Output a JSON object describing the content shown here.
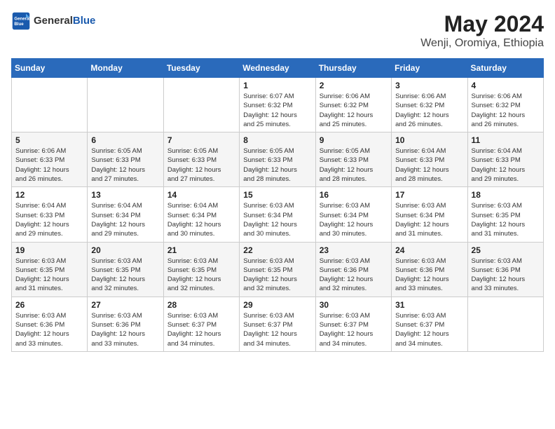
{
  "header": {
    "logo_general": "General",
    "logo_blue": "Blue",
    "title": "May 2024",
    "location": "Wenji, Oromiya, Ethiopia"
  },
  "days_of_week": [
    "Sunday",
    "Monday",
    "Tuesday",
    "Wednesday",
    "Thursday",
    "Friday",
    "Saturday"
  ],
  "weeks": [
    [
      {
        "day": "",
        "info": ""
      },
      {
        "day": "",
        "info": ""
      },
      {
        "day": "",
        "info": ""
      },
      {
        "day": "1",
        "info": "Sunrise: 6:07 AM\nSunset: 6:32 PM\nDaylight: 12 hours\nand 25 minutes."
      },
      {
        "day": "2",
        "info": "Sunrise: 6:06 AM\nSunset: 6:32 PM\nDaylight: 12 hours\nand 25 minutes."
      },
      {
        "day": "3",
        "info": "Sunrise: 6:06 AM\nSunset: 6:32 PM\nDaylight: 12 hours\nand 26 minutes."
      },
      {
        "day": "4",
        "info": "Sunrise: 6:06 AM\nSunset: 6:32 PM\nDaylight: 12 hours\nand 26 minutes."
      }
    ],
    [
      {
        "day": "5",
        "info": "Sunrise: 6:06 AM\nSunset: 6:33 PM\nDaylight: 12 hours\nand 26 minutes."
      },
      {
        "day": "6",
        "info": "Sunrise: 6:05 AM\nSunset: 6:33 PM\nDaylight: 12 hours\nand 27 minutes."
      },
      {
        "day": "7",
        "info": "Sunrise: 6:05 AM\nSunset: 6:33 PM\nDaylight: 12 hours\nand 27 minutes."
      },
      {
        "day": "8",
        "info": "Sunrise: 6:05 AM\nSunset: 6:33 PM\nDaylight: 12 hours\nand 28 minutes."
      },
      {
        "day": "9",
        "info": "Sunrise: 6:05 AM\nSunset: 6:33 PM\nDaylight: 12 hours\nand 28 minutes."
      },
      {
        "day": "10",
        "info": "Sunrise: 6:04 AM\nSunset: 6:33 PM\nDaylight: 12 hours\nand 28 minutes."
      },
      {
        "day": "11",
        "info": "Sunrise: 6:04 AM\nSunset: 6:33 PM\nDaylight: 12 hours\nand 29 minutes."
      }
    ],
    [
      {
        "day": "12",
        "info": "Sunrise: 6:04 AM\nSunset: 6:33 PM\nDaylight: 12 hours\nand 29 minutes."
      },
      {
        "day": "13",
        "info": "Sunrise: 6:04 AM\nSunset: 6:34 PM\nDaylight: 12 hours\nand 29 minutes."
      },
      {
        "day": "14",
        "info": "Sunrise: 6:04 AM\nSunset: 6:34 PM\nDaylight: 12 hours\nand 30 minutes."
      },
      {
        "day": "15",
        "info": "Sunrise: 6:03 AM\nSunset: 6:34 PM\nDaylight: 12 hours\nand 30 minutes."
      },
      {
        "day": "16",
        "info": "Sunrise: 6:03 AM\nSunset: 6:34 PM\nDaylight: 12 hours\nand 30 minutes."
      },
      {
        "day": "17",
        "info": "Sunrise: 6:03 AM\nSunset: 6:34 PM\nDaylight: 12 hours\nand 31 minutes."
      },
      {
        "day": "18",
        "info": "Sunrise: 6:03 AM\nSunset: 6:35 PM\nDaylight: 12 hours\nand 31 minutes."
      }
    ],
    [
      {
        "day": "19",
        "info": "Sunrise: 6:03 AM\nSunset: 6:35 PM\nDaylight: 12 hours\nand 31 minutes."
      },
      {
        "day": "20",
        "info": "Sunrise: 6:03 AM\nSunset: 6:35 PM\nDaylight: 12 hours\nand 32 minutes."
      },
      {
        "day": "21",
        "info": "Sunrise: 6:03 AM\nSunset: 6:35 PM\nDaylight: 12 hours\nand 32 minutes."
      },
      {
        "day": "22",
        "info": "Sunrise: 6:03 AM\nSunset: 6:35 PM\nDaylight: 12 hours\nand 32 minutes."
      },
      {
        "day": "23",
        "info": "Sunrise: 6:03 AM\nSunset: 6:36 PM\nDaylight: 12 hours\nand 32 minutes."
      },
      {
        "day": "24",
        "info": "Sunrise: 6:03 AM\nSunset: 6:36 PM\nDaylight: 12 hours\nand 33 minutes."
      },
      {
        "day": "25",
        "info": "Sunrise: 6:03 AM\nSunset: 6:36 PM\nDaylight: 12 hours\nand 33 minutes."
      }
    ],
    [
      {
        "day": "26",
        "info": "Sunrise: 6:03 AM\nSunset: 6:36 PM\nDaylight: 12 hours\nand 33 minutes."
      },
      {
        "day": "27",
        "info": "Sunrise: 6:03 AM\nSunset: 6:36 PM\nDaylight: 12 hours\nand 33 minutes."
      },
      {
        "day": "28",
        "info": "Sunrise: 6:03 AM\nSunset: 6:37 PM\nDaylight: 12 hours\nand 34 minutes."
      },
      {
        "day": "29",
        "info": "Sunrise: 6:03 AM\nSunset: 6:37 PM\nDaylight: 12 hours\nand 34 minutes."
      },
      {
        "day": "30",
        "info": "Sunrise: 6:03 AM\nSunset: 6:37 PM\nDaylight: 12 hours\nand 34 minutes."
      },
      {
        "day": "31",
        "info": "Sunrise: 6:03 AM\nSunset: 6:37 PM\nDaylight: 12 hours\nand 34 minutes."
      },
      {
        "day": "",
        "info": ""
      }
    ]
  ]
}
